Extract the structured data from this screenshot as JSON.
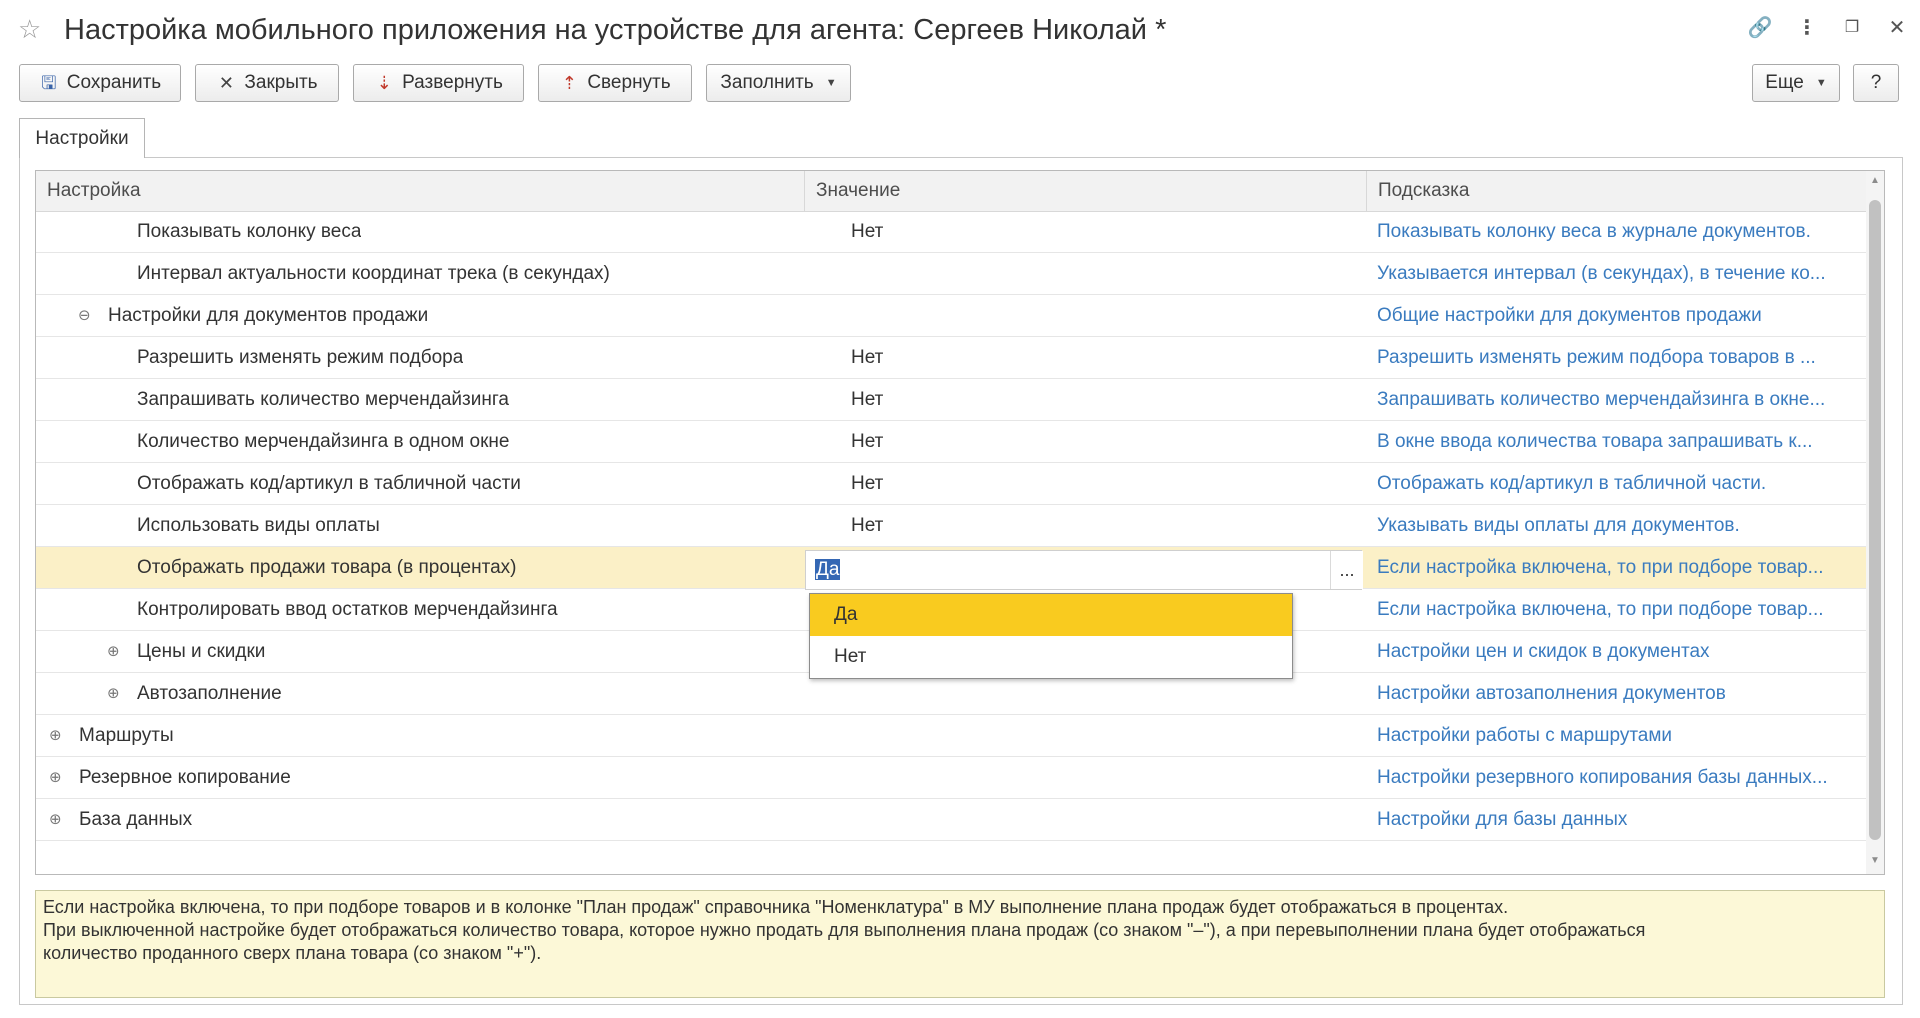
{
  "window": {
    "title": "Настройка мобильного приложения на устройстве для агента: Сергеев Николай *"
  },
  "toolbar": {
    "save_label": "Сохранить",
    "close_label": "Закрыть",
    "expand_label": "Развернуть",
    "collapse_label": "Свернуть",
    "fill_label": "Заполнить",
    "more_label": "Еще",
    "help_label": "?"
  },
  "tabs": [
    {
      "label": "Настройки"
    }
  ],
  "table": {
    "columns": [
      "Настройка",
      "Значение",
      "Подсказка"
    ],
    "rows": [
      {
        "name": "Показывать колонку веса",
        "value": "Нет",
        "hint": "Показывать колонку веса в журнале документов."
      },
      {
        "name": "Интервал актуальности координат трека (в секундах)",
        "value": "",
        "hint": "Указывается интервал (в секундах), в течение ко..."
      },
      {
        "name": "Настройки для документов продажи",
        "value": "",
        "hint": "Общие настройки для документов продажи",
        "tree": "⊖"
      },
      {
        "name": "Разрешить изменять режим подбора",
        "value": "Нет",
        "hint": "Разрешить изменять режим подбора товаров в ..."
      },
      {
        "name": "Запрашивать количество мерчендайзинга",
        "value": "Нет",
        "hint": "Запрашивать количество мерчендайзинга в окне..."
      },
      {
        "name": "Количество мерчендайзинга в одном окне",
        "value": "Нет",
        "hint": "В окне ввода количества товара запрашивать к..."
      },
      {
        "name": "Отображать код/артикул в табличной части",
        "value": "Нет",
        "hint": "Отображать код/артикул в табличной части."
      },
      {
        "name": "Использовать виды оплаты",
        "value": "Нет",
        "hint": "Указывать виды оплаты для документов."
      },
      {
        "name": "Отображать продажи товара (в процентах)",
        "value": "Да",
        "hint": "Если настройка включена, то при подборе товар..."
      },
      {
        "name": "Контролировать ввод остатков мерчендайзинга",
        "value": "",
        "hint": "Если настройка включена, то при подборе товар..."
      },
      {
        "name": "Цены и скидки",
        "value": "",
        "hint": "Настройки цен и скидок в документах",
        "tree": "⊕"
      },
      {
        "name": "Автозаполнение",
        "value": "",
        "hint": "Настройки автозаполнения документов",
        "tree": "⊕"
      },
      {
        "name": "Маршруты",
        "value": "",
        "hint": "Настройки работы с маршрутами",
        "tree": "⊕"
      },
      {
        "name": "Резервное копирование",
        "value": "",
        "hint": "Настройки резервного копирования базы данных...",
        "tree": "⊕"
      },
      {
        "name": "База данных",
        "value": "",
        "hint": "Настройки для базы данных",
        "tree": "⊕"
      }
    ]
  },
  "editor": {
    "value": "Да",
    "choice_button": "...",
    "options": [
      "Да",
      "Нет"
    ]
  },
  "hint_text": {
    "line1": "Если настройка включена, то при подборе товаров и в колонке \"План продаж\" справочника \"Номенклатура\" в МУ выполнение плана продаж будет отображаться в процентах.",
    "line2": "При выключенной настройке будет отображаться количество товара, которое нужно продать для выполнения плана продаж (со знаком \"–\"), а при перевыполнении плана будет отображаться",
    "line3": "количество проданного сверх плана товара (со знаком \"+\")."
  },
  "colors": {
    "hint_link": "#3a7bbf",
    "selected_row": "#fbf0c7",
    "dropdown_active": "#f9cb1f",
    "hint_box_bg": "#fcf8d7"
  }
}
